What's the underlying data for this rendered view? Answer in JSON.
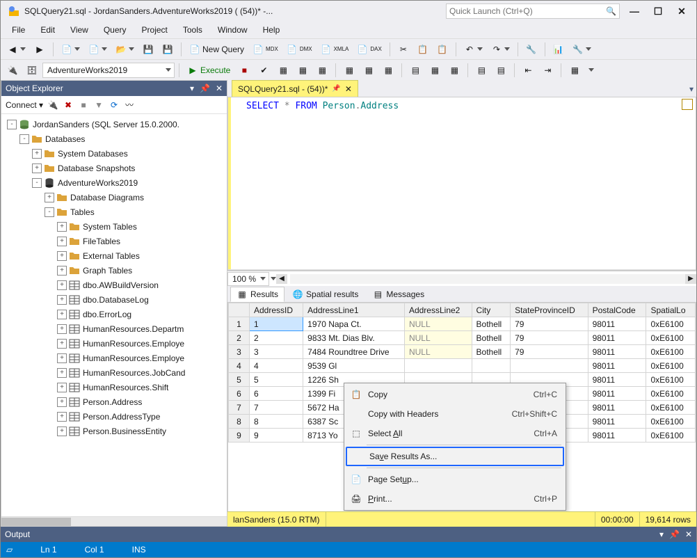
{
  "title": "SQLQuery21.sql - JordanSanders.AdventureWorks2019 (                         (54))* -...",
  "quick_launch_placeholder": "Quick Launch (Ctrl+Q)",
  "menu": [
    "File",
    "Edit",
    "View",
    "Query",
    "Project",
    "Tools",
    "Window",
    "Help"
  ],
  "toolbar1": {
    "new_query": "New Query",
    "mdx": "MDX",
    "dmx": "DMX",
    "xmla": "XMLA",
    "dax": "DAX"
  },
  "toolbar2": {
    "db_combo": "AdventureWorks2019",
    "execute": "Execute"
  },
  "object_explorer": {
    "title": "Object Explorer",
    "connect": "Connect",
    "tree": [
      {
        "d": 0,
        "exp": "-",
        "icon": "server",
        "label": "JordanSanders (SQL Server 15.0.2000."
      },
      {
        "d": 1,
        "exp": "-",
        "icon": "folder",
        "label": "Databases"
      },
      {
        "d": 2,
        "exp": "+",
        "icon": "folder",
        "label": "System Databases"
      },
      {
        "d": 2,
        "exp": "+",
        "icon": "folder",
        "label": "Database Snapshots"
      },
      {
        "d": 2,
        "exp": "-",
        "icon": "db",
        "label": "AdventureWorks2019"
      },
      {
        "d": 3,
        "exp": "+",
        "icon": "folder",
        "label": "Database Diagrams"
      },
      {
        "d": 3,
        "exp": "-",
        "icon": "folder",
        "label": "Tables"
      },
      {
        "d": 4,
        "exp": "+",
        "icon": "folder",
        "label": "System Tables"
      },
      {
        "d": 4,
        "exp": "+",
        "icon": "folder",
        "label": "FileTables"
      },
      {
        "d": 4,
        "exp": "+",
        "icon": "folder",
        "label": "External Tables"
      },
      {
        "d": 4,
        "exp": "+",
        "icon": "folder",
        "label": "Graph Tables"
      },
      {
        "d": 4,
        "exp": "+",
        "icon": "table",
        "label": "dbo.AWBuildVersion"
      },
      {
        "d": 4,
        "exp": "+",
        "icon": "table",
        "label": "dbo.DatabaseLog"
      },
      {
        "d": 4,
        "exp": "+",
        "icon": "table",
        "label": "dbo.ErrorLog"
      },
      {
        "d": 4,
        "exp": "+",
        "icon": "table",
        "label": "HumanResources.Departm"
      },
      {
        "d": 4,
        "exp": "+",
        "icon": "table",
        "label": "HumanResources.Employe"
      },
      {
        "d": 4,
        "exp": "+",
        "icon": "table",
        "label": "HumanResources.Employe"
      },
      {
        "d": 4,
        "exp": "+",
        "icon": "table",
        "label": "HumanResources.JobCand"
      },
      {
        "d": 4,
        "exp": "+",
        "icon": "table",
        "label": "HumanResources.Shift"
      },
      {
        "d": 4,
        "exp": "+",
        "icon": "table",
        "label": "Person.Address"
      },
      {
        "d": 4,
        "exp": "+",
        "icon": "table",
        "label": "Person.AddressType"
      },
      {
        "d": 4,
        "exp": "+",
        "icon": "table",
        "label": "Person.BusinessEntity"
      }
    ]
  },
  "editor_tab": "SQLQuery21.sql -                           (54))*",
  "sql": {
    "select": "SELECT",
    "star": "*",
    "from": "FROM",
    "schema": "Person",
    "dot": ".",
    "table": "Address"
  },
  "zoom": "100 %",
  "results_tabs": {
    "results": "Results",
    "spatial": "Spatial results",
    "messages": "Messages"
  },
  "grid": {
    "columns": [
      "",
      "AddressID",
      "AddressLine1",
      "AddressLine2",
      "City",
      "StateProvinceID",
      "PostalCode",
      "SpatialLo"
    ],
    "rows": [
      [
        "1",
        "1",
        "1970 Napa Ct.",
        "NULL",
        "Bothell",
        "79",
        "98011",
        "0xE6100"
      ],
      [
        "2",
        "2",
        "9833 Mt. Dias Blv.",
        "NULL",
        "Bothell",
        "79",
        "98011",
        "0xE6100"
      ],
      [
        "3",
        "3",
        "7484 Roundtree Drive",
        "NULL",
        "Bothell",
        "79",
        "98011",
        "0xE6100"
      ],
      [
        "4",
        "4",
        "9539 Gl",
        "",
        "",
        "",
        "98011",
        "0xE6100"
      ],
      [
        "5",
        "5",
        "1226 Sh",
        "",
        "",
        "",
        "98011",
        "0xE6100"
      ],
      [
        "6",
        "6",
        "1399 Fi",
        "",
        "",
        "",
        "98011",
        "0xE6100"
      ],
      [
        "7",
        "7",
        "5672 Ha",
        "",
        "",
        "",
        "98011",
        "0xE6100"
      ],
      [
        "8",
        "8",
        "6387 Sc",
        "",
        "",
        "",
        "98011",
        "0xE6100"
      ],
      [
        "9",
        "9",
        "8713 Yo",
        "",
        "",
        "",
        "98011",
        "0xE6100"
      ]
    ]
  },
  "ctx": {
    "copy": "Copy",
    "copy_sc": "Ctrl+C",
    "copy_headers": "Copy with Headers",
    "copy_headers_sc": "Ctrl+Shift+C",
    "select_all_pre": "Select ",
    "select_all_ul": "A",
    "select_all_post": "ll",
    "select_all_sc": "Ctrl+A",
    "save_pre": "Sa",
    "save_ul": "v",
    "save_post": "e Results As...",
    "page_setup_pre": "Page Set",
    "page_setup_ul": "u",
    "page_setup_post": "p...",
    "print_ul": "P",
    "print_post": "rint...",
    "print_sc": "Ctrl+P"
  },
  "results_status": {
    "conn": "lanSanders (15.0 RTM)",
    "time": "00:00:00",
    "rows": "19,614 rows"
  },
  "output_title": "Output",
  "status": {
    "ln": "Ln 1",
    "col": "Col 1",
    "ins": "INS"
  }
}
